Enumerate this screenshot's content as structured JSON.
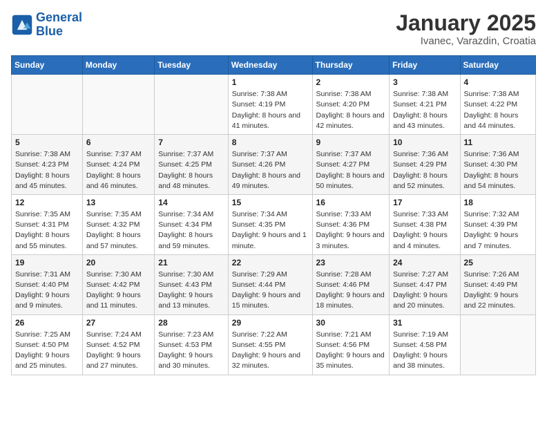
{
  "header": {
    "logo_line1": "General",
    "logo_line2": "Blue",
    "title": "January 2025",
    "subtitle": "Ivanec, Varazdin, Croatia"
  },
  "weekdays": [
    "Sunday",
    "Monday",
    "Tuesday",
    "Wednesday",
    "Thursday",
    "Friday",
    "Saturday"
  ],
  "weeks": [
    [
      {
        "num": "",
        "detail": ""
      },
      {
        "num": "",
        "detail": ""
      },
      {
        "num": "",
        "detail": ""
      },
      {
        "num": "1",
        "detail": "Sunrise: 7:38 AM\nSunset: 4:19 PM\nDaylight: 8 hours and 41 minutes."
      },
      {
        "num": "2",
        "detail": "Sunrise: 7:38 AM\nSunset: 4:20 PM\nDaylight: 8 hours and 42 minutes."
      },
      {
        "num": "3",
        "detail": "Sunrise: 7:38 AM\nSunset: 4:21 PM\nDaylight: 8 hours and 43 minutes."
      },
      {
        "num": "4",
        "detail": "Sunrise: 7:38 AM\nSunset: 4:22 PM\nDaylight: 8 hours and 44 minutes."
      }
    ],
    [
      {
        "num": "5",
        "detail": "Sunrise: 7:38 AM\nSunset: 4:23 PM\nDaylight: 8 hours and 45 minutes."
      },
      {
        "num": "6",
        "detail": "Sunrise: 7:37 AM\nSunset: 4:24 PM\nDaylight: 8 hours and 46 minutes."
      },
      {
        "num": "7",
        "detail": "Sunrise: 7:37 AM\nSunset: 4:25 PM\nDaylight: 8 hours and 48 minutes."
      },
      {
        "num": "8",
        "detail": "Sunrise: 7:37 AM\nSunset: 4:26 PM\nDaylight: 8 hours and 49 minutes."
      },
      {
        "num": "9",
        "detail": "Sunrise: 7:37 AM\nSunset: 4:27 PM\nDaylight: 8 hours and 50 minutes."
      },
      {
        "num": "10",
        "detail": "Sunrise: 7:36 AM\nSunset: 4:29 PM\nDaylight: 8 hours and 52 minutes."
      },
      {
        "num": "11",
        "detail": "Sunrise: 7:36 AM\nSunset: 4:30 PM\nDaylight: 8 hours and 54 minutes."
      }
    ],
    [
      {
        "num": "12",
        "detail": "Sunrise: 7:35 AM\nSunset: 4:31 PM\nDaylight: 8 hours and 55 minutes."
      },
      {
        "num": "13",
        "detail": "Sunrise: 7:35 AM\nSunset: 4:32 PM\nDaylight: 8 hours and 57 minutes."
      },
      {
        "num": "14",
        "detail": "Sunrise: 7:34 AM\nSunset: 4:34 PM\nDaylight: 8 hours and 59 minutes."
      },
      {
        "num": "15",
        "detail": "Sunrise: 7:34 AM\nSunset: 4:35 PM\nDaylight: 9 hours and 1 minute."
      },
      {
        "num": "16",
        "detail": "Sunrise: 7:33 AM\nSunset: 4:36 PM\nDaylight: 9 hours and 3 minutes."
      },
      {
        "num": "17",
        "detail": "Sunrise: 7:33 AM\nSunset: 4:38 PM\nDaylight: 9 hours and 4 minutes."
      },
      {
        "num": "18",
        "detail": "Sunrise: 7:32 AM\nSunset: 4:39 PM\nDaylight: 9 hours and 7 minutes."
      }
    ],
    [
      {
        "num": "19",
        "detail": "Sunrise: 7:31 AM\nSunset: 4:40 PM\nDaylight: 9 hours and 9 minutes."
      },
      {
        "num": "20",
        "detail": "Sunrise: 7:30 AM\nSunset: 4:42 PM\nDaylight: 9 hours and 11 minutes."
      },
      {
        "num": "21",
        "detail": "Sunrise: 7:30 AM\nSunset: 4:43 PM\nDaylight: 9 hours and 13 minutes."
      },
      {
        "num": "22",
        "detail": "Sunrise: 7:29 AM\nSunset: 4:44 PM\nDaylight: 9 hours and 15 minutes."
      },
      {
        "num": "23",
        "detail": "Sunrise: 7:28 AM\nSunset: 4:46 PM\nDaylight: 9 hours and 18 minutes."
      },
      {
        "num": "24",
        "detail": "Sunrise: 7:27 AM\nSunset: 4:47 PM\nDaylight: 9 hours and 20 minutes."
      },
      {
        "num": "25",
        "detail": "Sunrise: 7:26 AM\nSunset: 4:49 PM\nDaylight: 9 hours and 22 minutes."
      }
    ],
    [
      {
        "num": "26",
        "detail": "Sunrise: 7:25 AM\nSunset: 4:50 PM\nDaylight: 9 hours and 25 minutes."
      },
      {
        "num": "27",
        "detail": "Sunrise: 7:24 AM\nSunset: 4:52 PM\nDaylight: 9 hours and 27 minutes."
      },
      {
        "num": "28",
        "detail": "Sunrise: 7:23 AM\nSunset: 4:53 PM\nDaylight: 9 hours and 30 minutes."
      },
      {
        "num": "29",
        "detail": "Sunrise: 7:22 AM\nSunset: 4:55 PM\nDaylight: 9 hours and 32 minutes."
      },
      {
        "num": "30",
        "detail": "Sunrise: 7:21 AM\nSunset: 4:56 PM\nDaylight: 9 hours and 35 minutes."
      },
      {
        "num": "31",
        "detail": "Sunrise: 7:19 AM\nSunset: 4:58 PM\nDaylight: 9 hours and 38 minutes."
      },
      {
        "num": "",
        "detail": ""
      }
    ]
  ]
}
